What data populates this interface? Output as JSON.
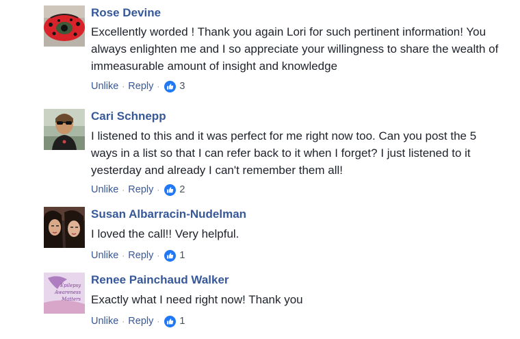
{
  "comments": [
    {
      "author": "Rose Devine",
      "avatar_icon": "ladybug-eye-avatar",
      "text": "Excellently worded ! Thank you again Lori for such pertinent information! You always enlighten me and I so appreciate your willingness to share the wealth of immeasurable amount of insight and knowledge",
      "unlike_label": "Unlike",
      "reply_label": "Reply",
      "like_count": "3"
    },
    {
      "author": "Cari Schnepp",
      "avatar_icon": "woman-sunglasses-avatar",
      "text": "I listened to this and it was perfect for me right now too. Can you post the 5 ways in a list so that I can refer back to it when I forget? I just listened to it yesterday and already I can't remember them all!",
      "unlike_label": "Unlike",
      "reply_label": "Reply",
      "like_count": "2"
    },
    {
      "author": "Susan Albarracin-Nudelman",
      "avatar_icon": "two-women-avatar",
      "text": "I loved the call!! Very helpful.",
      "unlike_label": "Unlike",
      "reply_label": "Reply",
      "like_count": "1"
    },
    {
      "author": "Renee Painchaud Walker",
      "avatar_icon": "epilepsy-awareness-avatar",
      "avatar_text": "Epilepsy Awareness Matters",
      "text": "Exactly what I need right now! Thank you",
      "unlike_label": "Unlike",
      "reply_label": "Reply",
      "like_count": "1"
    }
  ],
  "separator": "·",
  "colors": {
    "link": "#365899",
    "text": "#1d2129",
    "like_blue": "#2078f4",
    "meta": "#90949c"
  }
}
